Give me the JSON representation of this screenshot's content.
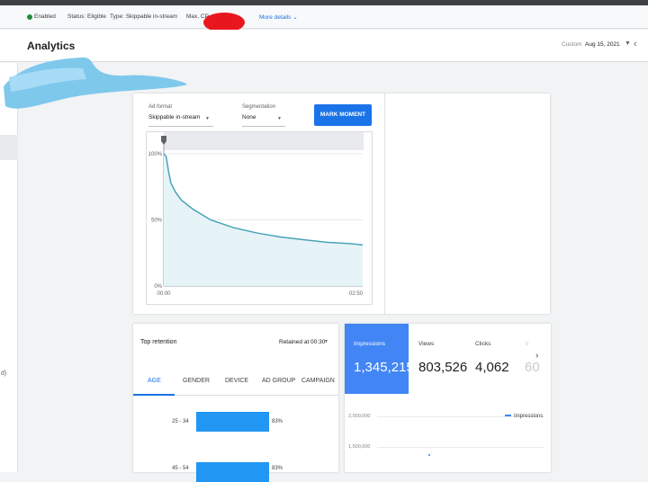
{
  "status_bar": {
    "enabled": "Enabled",
    "status": "Status: Eligible",
    "type": "Type: Skippable in-stream",
    "max_cpv": "Max. CP",
    "more_details": "More details"
  },
  "header": {
    "sidebar_cut": "ons",
    "title": "Analytics",
    "custom_label": "Custom",
    "date": "Aug 15, 2021"
  },
  "leftnav": {
    "glyph": "d)"
  },
  "retention_card": {
    "ad_format_label": "Ad format",
    "ad_format_value": "Skippable in-stream",
    "segmentation_label": "Segmentation",
    "segmentation_value": "None",
    "mark_moment": "MARK MOMENT"
  },
  "chart_data": {
    "type": "line",
    "title": "",
    "xlabel": "",
    "ylabel": "",
    "x_ticks": [
      "00:00",
      "02:50"
    ],
    "y_ticks": [
      "100%",
      "50%",
      "0%"
    ],
    "ylim": [
      0,
      100
    ],
    "series": [
      {
        "color": "#4aa3b8",
        "x": [
          0,
          2,
          4,
          6,
          10,
          15,
          25,
          40,
          60,
          80,
          100,
          120,
          140,
          160,
          170
        ],
        "y": [
          100,
          98,
          87,
          78,
          71,
          65,
          58,
          50,
          44,
          40,
          37,
          35,
          33,
          32,
          31
        ]
      }
    ],
    "grid": true,
    "legend": "none"
  },
  "top_retention": {
    "title": "Top retention",
    "retained_at": "Retained at 00:30",
    "tabs": [
      "AGE",
      "GENDER",
      "DEVICE",
      "AD GROUP",
      "CAMPAIGN"
    ],
    "rows": [
      {
        "label": "25 - 34",
        "value": 83,
        "pct": "83%"
      },
      {
        "label": "45 - 54",
        "value": 83,
        "pct": "83%"
      }
    ]
  },
  "metrics": {
    "items": [
      {
        "label": "Impressions",
        "value": "1,345,215"
      },
      {
        "label": "Views",
        "value": "803,526"
      },
      {
        "label": "Clicks",
        "value": "4,062"
      },
      {
        "label": "V",
        "value": "60"
      }
    ],
    "y_ticks": [
      "2,000,000",
      "1,500,000"
    ],
    "legend_label": "Impressions"
  },
  "colors": {
    "accent": "#1a73e8",
    "metric_active": "#4285f4",
    "bar": "#2196f3",
    "enabled_dot": "#1e8e3e"
  }
}
